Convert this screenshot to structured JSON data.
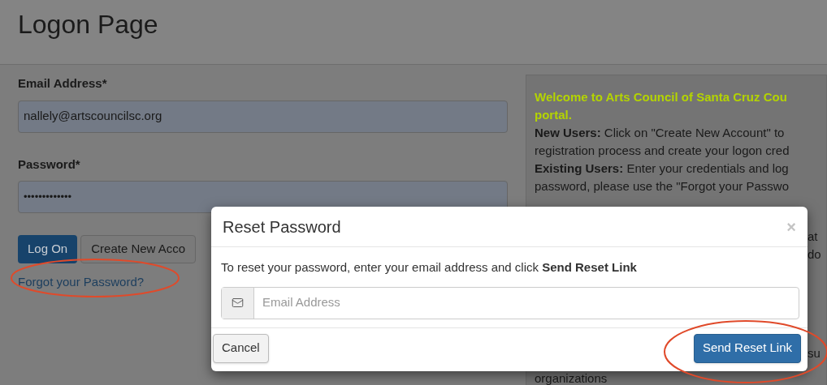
{
  "page": {
    "title": "Logon Page",
    "form": {
      "email_label": "Email Address*",
      "email_value": "nallely@artscouncilsc.org",
      "password_label": "Password*",
      "password_value": "•••••••••••••",
      "buttons": [
        "Log On",
        "Create New Acco"
      ],
      "forgot_link": "Forgot your Password?"
    },
    "info_panel": {
      "heading_lines": [
        "Welcome to Arts Council of Santa Cruz Cou",
        "portal."
      ],
      "lines": [
        {
          "bold": "New Users:",
          "text": " Click on \"Create New Account\" to"
        },
        {
          "text": "registration process and create your logon cred"
        },
        {
          "bold": "Existing Users:",
          "text": " Enter your credentials and log"
        },
        {
          "text": "password, please use the \"Forgot your Passwo"
        }
      ],
      "fragments": [
        "at",
        "do",
        "su",
        "organizations"
      ]
    }
  },
  "modal": {
    "title": "Reset Password",
    "close": "×",
    "instructions": "To reset your password, enter your email address and click **Send Reset Link**",
    "email_field": {
      "placeholder": "Email Address"
    },
    "buttons": [
      {
        "label": "Cancel",
        "kind": "default"
      },
      {
        "label": "Send Reset Link",
        "kind": "primary"
      }
    ]
  }
}
